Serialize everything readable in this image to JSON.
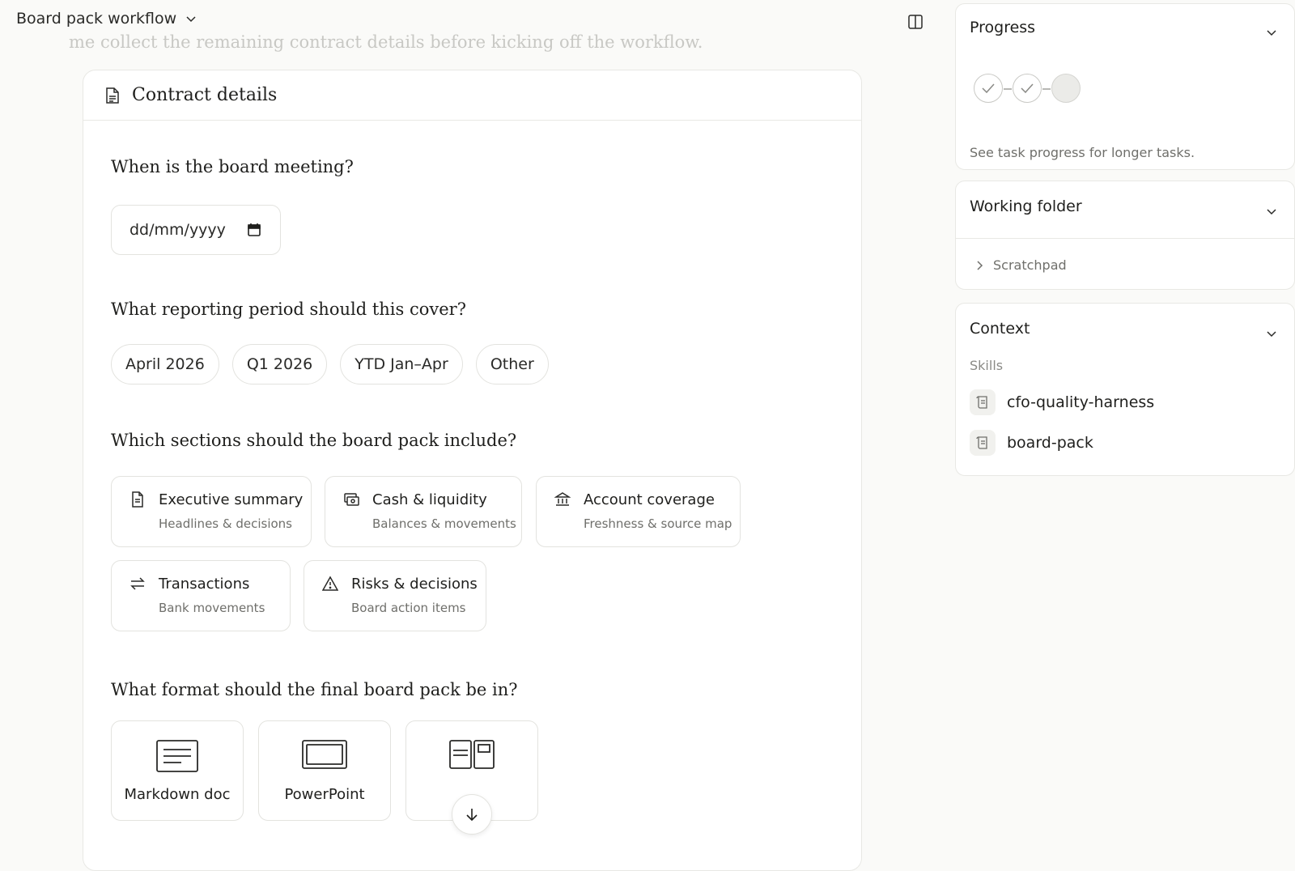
{
  "header": {
    "workflow_title": "Board pack workflow",
    "faded_message": "me collect the remaining contract details before kicking off the workflow."
  },
  "form": {
    "card_title": "Contract details",
    "q_meeting": "When is the board meeting?",
    "date_placeholder": "dd/mm/yyyy",
    "q_period": "What reporting period should this cover?",
    "periods": [
      "April 2026",
      "Q1 2026",
      "YTD Jan–Apr",
      "Other"
    ],
    "q_sections": "Which sections should the board pack include?",
    "sections": [
      {
        "title": "Executive summary",
        "subtitle": "Headlines & decisions",
        "icon": "document-icon"
      },
      {
        "title": "Cash & liquidity",
        "subtitle": "Balances & movements",
        "icon": "cash-icon"
      },
      {
        "title": "Account coverage",
        "subtitle": "Freshness & source map",
        "icon": "bank-icon"
      },
      {
        "title": "Transactions",
        "subtitle": "Bank movements",
        "icon": "swap-arrows-icon"
      },
      {
        "title": "Risks & decisions",
        "subtitle": "Board action items",
        "icon": "warning-icon"
      }
    ],
    "q_format": "What format should the final board pack be in?",
    "formats": [
      {
        "label": "Markdown doc",
        "icon": "markdown-doc-icon"
      },
      {
        "label": "PowerPoint",
        "icon": "slides-icon"
      },
      {
        "label": "",
        "icon": "dashboard-layout-icon"
      }
    ]
  },
  "sidebar": {
    "progress": {
      "title": "Progress",
      "steps": [
        "done",
        "done",
        "pending"
      ],
      "note": "See task progress for longer tasks."
    },
    "working_folder": {
      "title": "Working folder",
      "items": [
        "Scratchpad"
      ]
    },
    "context": {
      "title": "Context",
      "skills_label": "Skills",
      "skills": [
        "cfo-quality-harness",
        "board-pack"
      ]
    }
  }
}
